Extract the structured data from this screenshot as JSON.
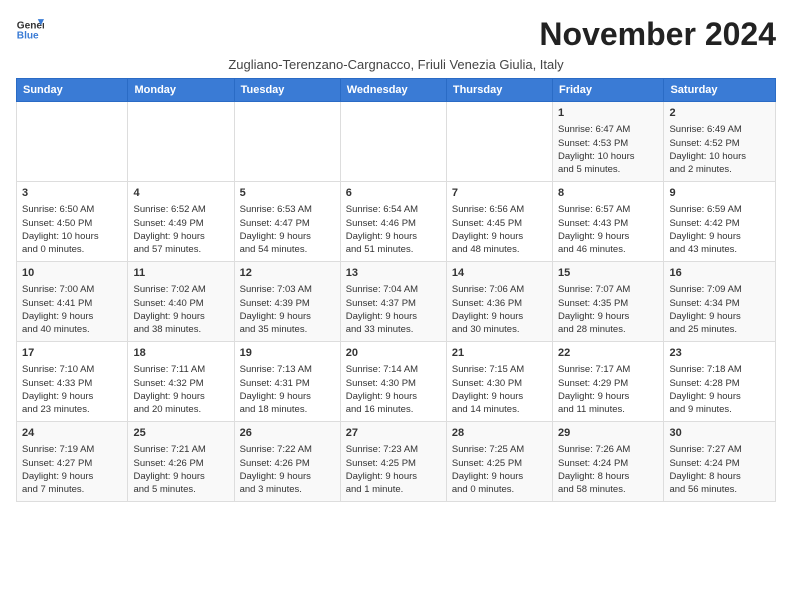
{
  "logo": {
    "line1": "General",
    "line2": "Blue"
  },
  "title": "November 2024",
  "subtitle": "Zugliano-Terenzano-Cargnacco, Friuli Venezia Giulia, Italy",
  "headers": [
    "Sunday",
    "Monday",
    "Tuesday",
    "Wednesday",
    "Thursday",
    "Friday",
    "Saturday"
  ],
  "weeks": [
    [
      {
        "day": "",
        "info": ""
      },
      {
        "day": "",
        "info": ""
      },
      {
        "day": "",
        "info": ""
      },
      {
        "day": "",
        "info": ""
      },
      {
        "day": "",
        "info": ""
      },
      {
        "day": "1",
        "info": "Sunrise: 6:47 AM\nSunset: 4:53 PM\nDaylight: 10 hours\nand 5 minutes."
      },
      {
        "day": "2",
        "info": "Sunrise: 6:49 AM\nSunset: 4:52 PM\nDaylight: 10 hours\nand 2 minutes."
      }
    ],
    [
      {
        "day": "3",
        "info": "Sunrise: 6:50 AM\nSunset: 4:50 PM\nDaylight: 10 hours\nand 0 minutes."
      },
      {
        "day": "4",
        "info": "Sunrise: 6:52 AM\nSunset: 4:49 PM\nDaylight: 9 hours\nand 57 minutes."
      },
      {
        "day": "5",
        "info": "Sunrise: 6:53 AM\nSunset: 4:47 PM\nDaylight: 9 hours\nand 54 minutes."
      },
      {
        "day": "6",
        "info": "Sunrise: 6:54 AM\nSunset: 4:46 PM\nDaylight: 9 hours\nand 51 minutes."
      },
      {
        "day": "7",
        "info": "Sunrise: 6:56 AM\nSunset: 4:45 PM\nDaylight: 9 hours\nand 48 minutes."
      },
      {
        "day": "8",
        "info": "Sunrise: 6:57 AM\nSunset: 4:43 PM\nDaylight: 9 hours\nand 46 minutes."
      },
      {
        "day": "9",
        "info": "Sunrise: 6:59 AM\nSunset: 4:42 PM\nDaylight: 9 hours\nand 43 minutes."
      }
    ],
    [
      {
        "day": "10",
        "info": "Sunrise: 7:00 AM\nSunset: 4:41 PM\nDaylight: 9 hours\nand 40 minutes."
      },
      {
        "day": "11",
        "info": "Sunrise: 7:02 AM\nSunset: 4:40 PM\nDaylight: 9 hours\nand 38 minutes."
      },
      {
        "day": "12",
        "info": "Sunrise: 7:03 AM\nSunset: 4:39 PM\nDaylight: 9 hours\nand 35 minutes."
      },
      {
        "day": "13",
        "info": "Sunrise: 7:04 AM\nSunset: 4:37 PM\nDaylight: 9 hours\nand 33 minutes."
      },
      {
        "day": "14",
        "info": "Sunrise: 7:06 AM\nSunset: 4:36 PM\nDaylight: 9 hours\nand 30 minutes."
      },
      {
        "day": "15",
        "info": "Sunrise: 7:07 AM\nSunset: 4:35 PM\nDaylight: 9 hours\nand 28 minutes."
      },
      {
        "day": "16",
        "info": "Sunrise: 7:09 AM\nSunset: 4:34 PM\nDaylight: 9 hours\nand 25 minutes."
      }
    ],
    [
      {
        "day": "17",
        "info": "Sunrise: 7:10 AM\nSunset: 4:33 PM\nDaylight: 9 hours\nand 23 minutes."
      },
      {
        "day": "18",
        "info": "Sunrise: 7:11 AM\nSunset: 4:32 PM\nDaylight: 9 hours\nand 20 minutes."
      },
      {
        "day": "19",
        "info": "Sunrise: 7:13 AM\nSunset: 4:31 PM\nDaylight: 9 hours\nand 18 minutes."
      },
      {
        "day": "20",
        "info": "Sunrise: 7:14 AM\nSunset: 4:30 PM\nDaylight: 9 hours\nand 16 minutes."
      },
      {
        "day": "21",
        "info": "Sunrise: 7:15 AM\nSunset: 4:30 PM\nDaylight: 9 hours\nand 14 minutes."
      },
      {
        "day": "22",
        "info": "Sunrise: 7:17 AM\nSunset: 4:29 PM\nDaylight: 9 hours\nand 11 minutes."
      },
      {
        "day": "23",
        "info": "Sunrise: 7:18 AM\nSunset: 4:28 PM\nDaylight: 9 hours\nand 9 minutes."
      }
    ],
    [
      {
        "day": "24",
        "info": "Sunrise: 7:19 AM\nSunset: 4:27 PM\nDaylight: 9 hours\nand 7 minutes."
      },
      {
        "day": "25",
        "info": "Sunrise: 7:21 AM\nSunset: 4:26 PM\nDaylight: 9 hours\nand 5 minutes."
      },
      {
        "day": "26",
        "info": "Sunrise: 7:22 AM\nSunset: 4:26 PM\nDaylight: 9 hours\nand 3 minutes."
      },
      {
        "day": "27",
        "info": "Sunrise: 7:23 AM\nSunset: 4:25 PM\nDaylight: 9 hours\nand 1 minute."
      },
      {
        "day": "28",
        "info": "Sunrise: 7:25 AM\nSunset: 4:25 PM\nDaylight: 9 hours\nand 0 minutes."
      },
      {
        "day": "29",
        "info": "Sunrise: 7:26 AM\nSunset: 4:24 PM\nDaylight: 8 hours\nand 58 minutes."
      },
      {
        "day": "30",
        "info": "Sunrise: 7:27 AM\nSunset: 4:24 PM\nDaylight: 8 hours\nand 56 minutes."
      }
    ]
  ]
}
